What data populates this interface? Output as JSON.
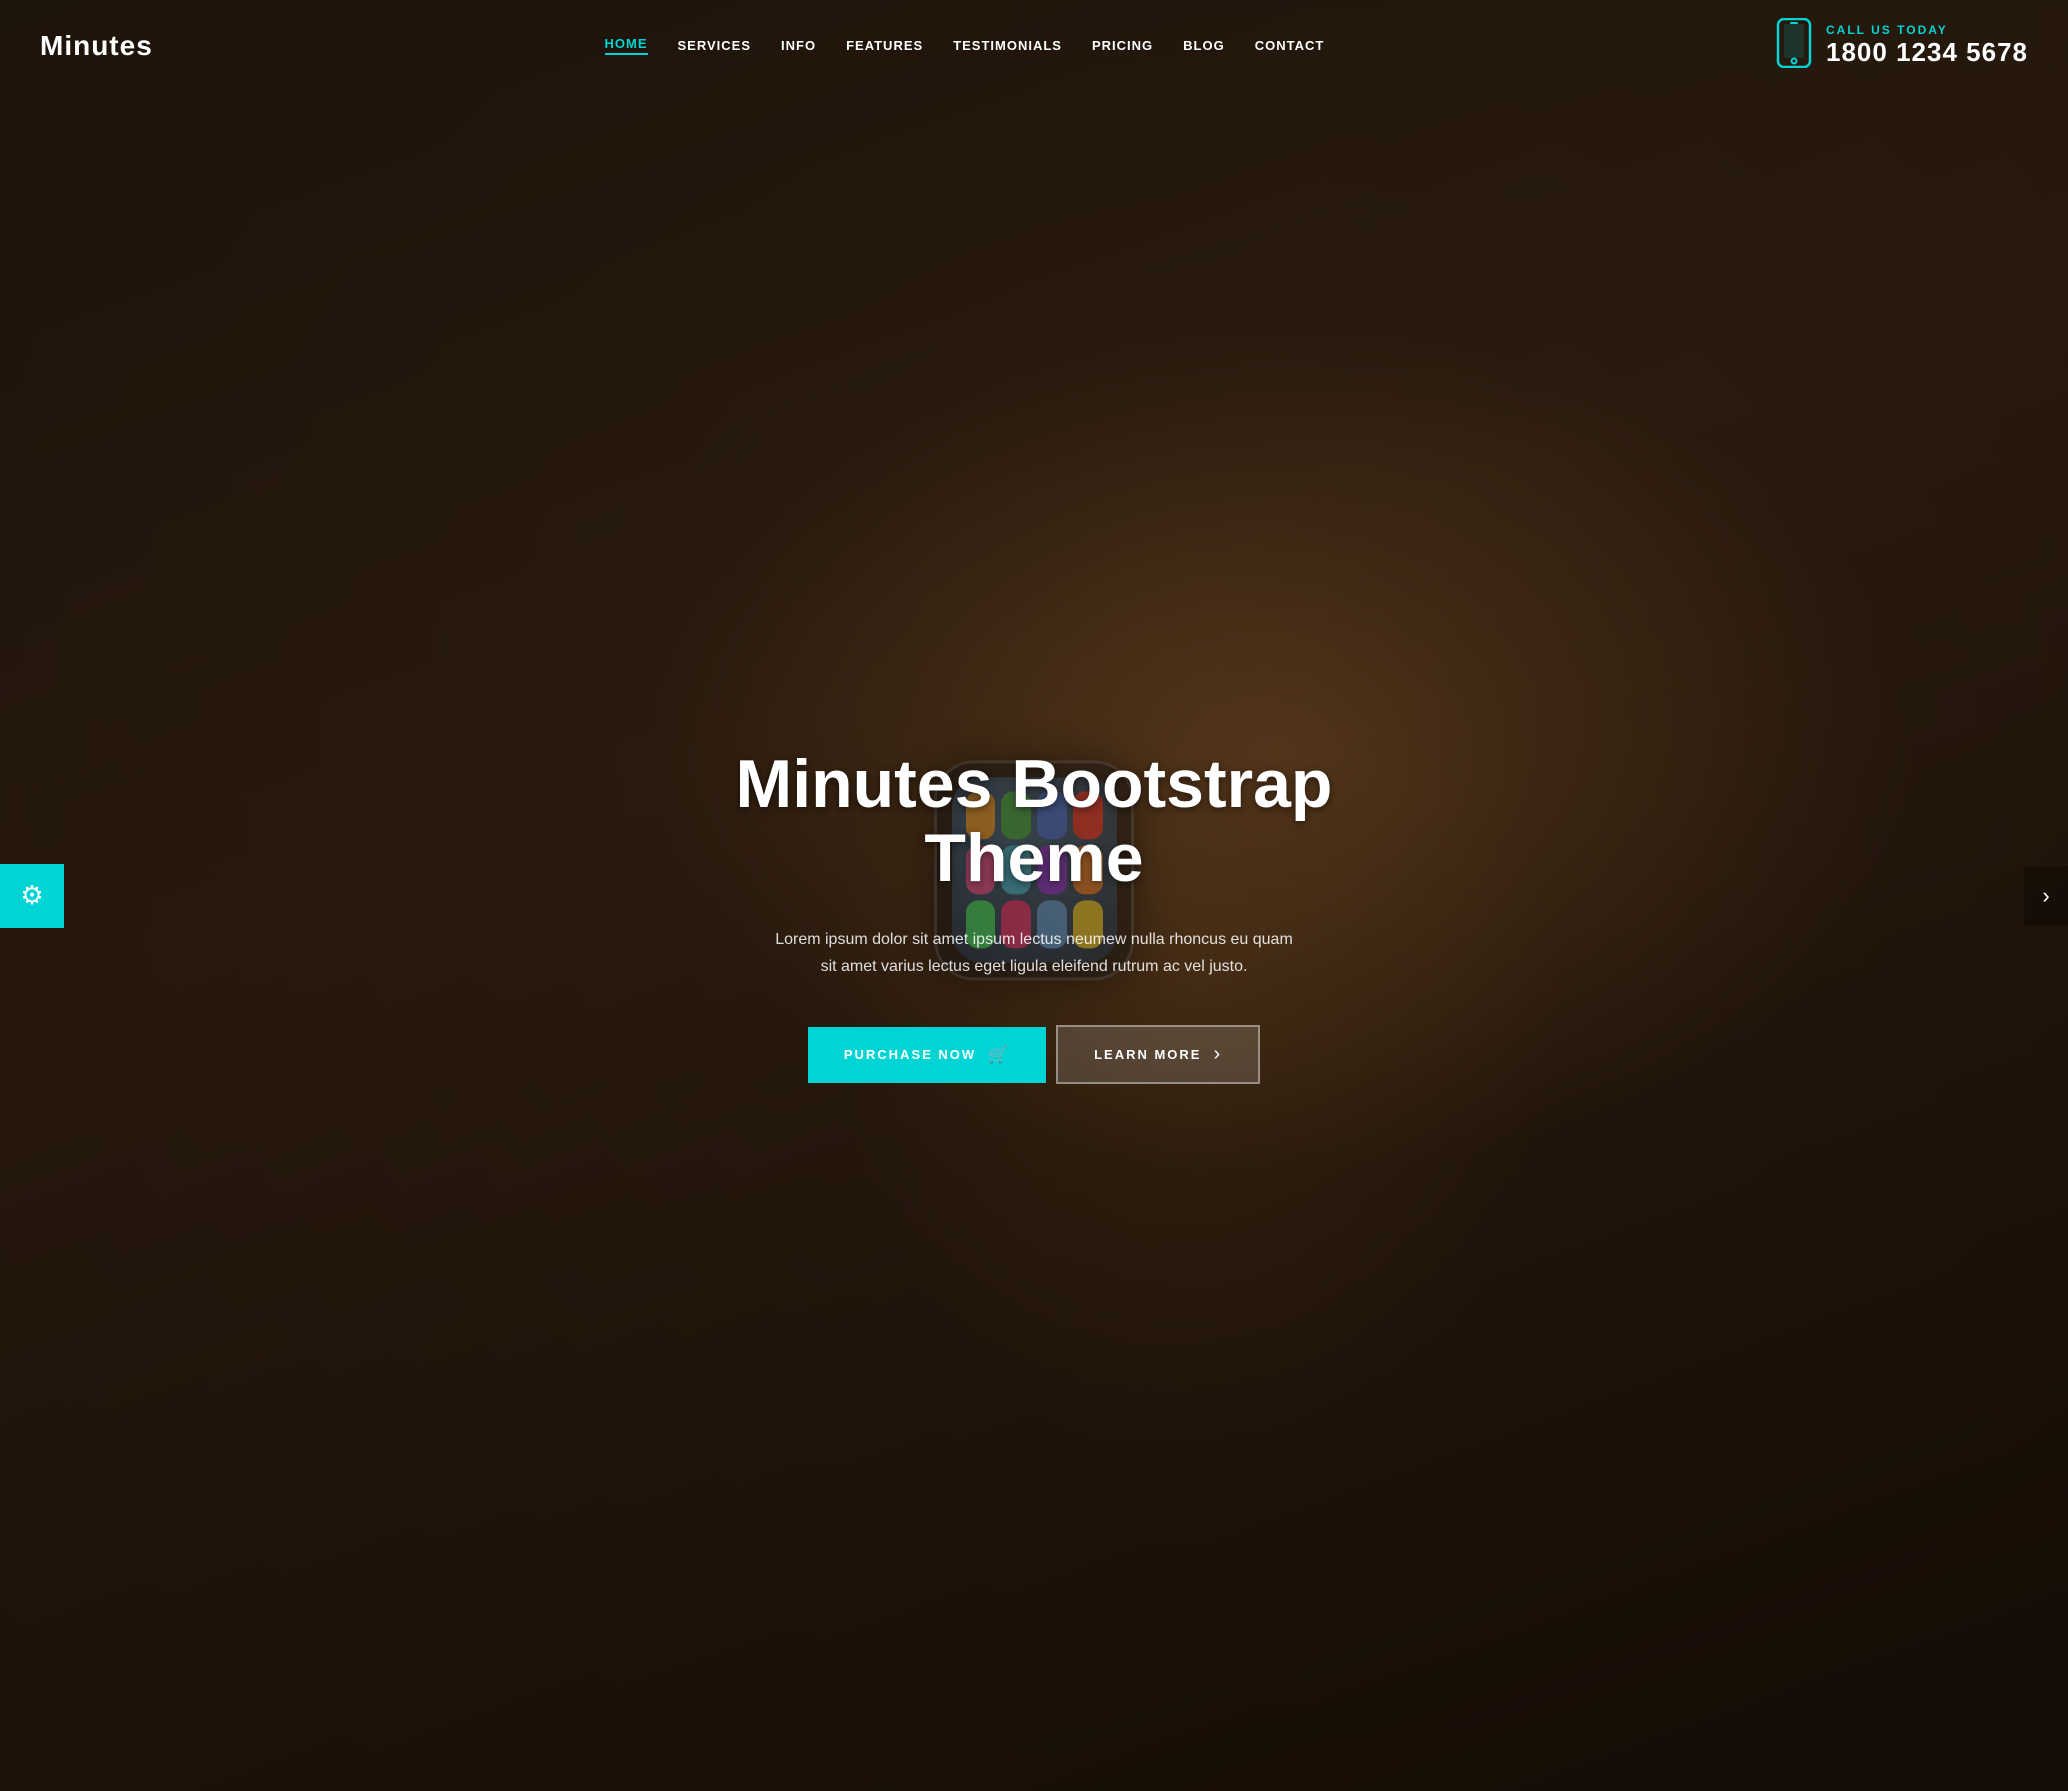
{
  "brand": {
    "logo": "Minutes"
  },
  "header": {
    "nav": [
      {
        "id": "home",
        "label": "HOME",
        "active": true
      },
      {
        "id": "services",
        "label": "SERVICES",
        "active": false
      },
      {
        "id": "info",
        "label": "INFO",
        "active": false
      },
      {
        "id": "features",
        "label": "FEATURES",
        "active": false
      },
      {
        "id": "testimonials",
        "label": "TESTIMONIALS",
        "active": false
      },
      {
        "id": "pricing",
        "label": "PRICING",
        "active": false
      },
      {
        "id": "blog",
        "label": "BLOG",
        "active": false
      },
      {
        "id": "contact",
        "label": "CONTACT",
        "active": false
      }
    ],
    "call_label": "CALL US TODAY",
    "phone": "1800 1234 5678"
  },
  "hero": {
    "title": "Minutes Bootstrap Theme",
    "subtitle": "Lorem ipsum dolor sit amet ipsum lectus neumew nulla rhoncus eu quam sit amet varius lectus eget ligula eleifend rutrum ac vel justo.",
    "btn_primary_label": "PURCHASE NOW",
    "btn_primary_icon": "🛒",
    "btn_secondary_label": "LEARN MORE",
    "btn_secondary_icon": "›"
  },
  "settings_btn": {
    "icon": "⚙"
  },
  "colors": {
    "accent": "#00d4d4",
    "bg_dark": "#14100a",
    "white": "#ffffff"
  },
  "watch_apps": [
    {
      "color": "#e8a030"
    },
    {
      "color": "#30b050"
    },
    {
      "color": "#3070e8"
    },
    {
      "color": "#e83030"
    },
    {
      "color": "#e850a0"
    },
    {
      "color": "#30c0e8"
    },
    {
      "color": "#8030e8"
    },
    {
      "color": "#e88030"
    },
    {
      "color": "#30e870"
    },
    {
      "color": "#e83080"
    },
    {
      "color": "#50a0e8"
    },
    {
      "color": "#e8d030"
    }
  ]
}
